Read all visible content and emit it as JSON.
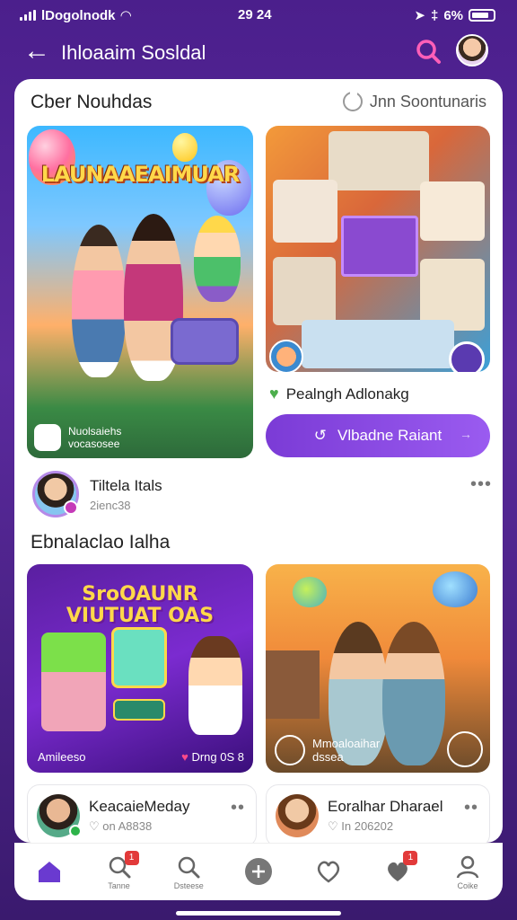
{
  "status": {
    "carrier": "lDogolnodk",
    "time": "29 24",
    "battery": "6%"
  },
  "header": {
    "title": "Ihloaaim Sosldal"
  },
  "section1": {
    "title": "Cber Nouhdas",
    "link": "Jnn Soontunaris"
  },
  "card1": {
    "poster_title": "LAUNAAEAIMUAR",
    "caption_line1": "Nuolsaiehs",
    "caption_line2": "vocasosee"
  },
  "card2": {
    "label": "Pealngh Adlonakg"
  },
  "button": {
    "label": "Vlbadne Raiant",
    "arrow": "→"
  },
  "user1": {
    "name": "Tiltela Itals",
    "sub": "2ienc38"
  },
  "section2": {
    "title": "Ebnalaclao Ialha"
  },
  "card3": {
    "title_line1": "SroOAUNR",
    "title_line2": "VIUTUAT OAS",
    "footer_left": "Amileeso",
    "footer_right": "Drng 0S 8"
  },
  "card4": {
    "caption_line1": "Mmoaloaihar",
    "caption_line2": "dssea"
  },
  "ucard1": {
    "name": "KeacaieMeday",
    "sub": "♡ on A8838"
  },
  "ucard2": {
    "name": "Eoralhar Dharael",
    "sub": "♡ In 206202"
  },
  "nav": {
    "items": [
      {
        "label": ""
      },
      {
        "label": "Tanne",
        "badge": "1"
      },
      {
        "label": "Dsteese"
      },
      {
        "label": ""
      },
      {
        "label": ""
      },
      {
        "label": "",
        "badge": "1"
      },
      {
        "label": "Coike"
      }
    ]
  },
  "colors": {
    "accent": "#7b3bd6",
    "background": "#4b1f8c"
  }
}
